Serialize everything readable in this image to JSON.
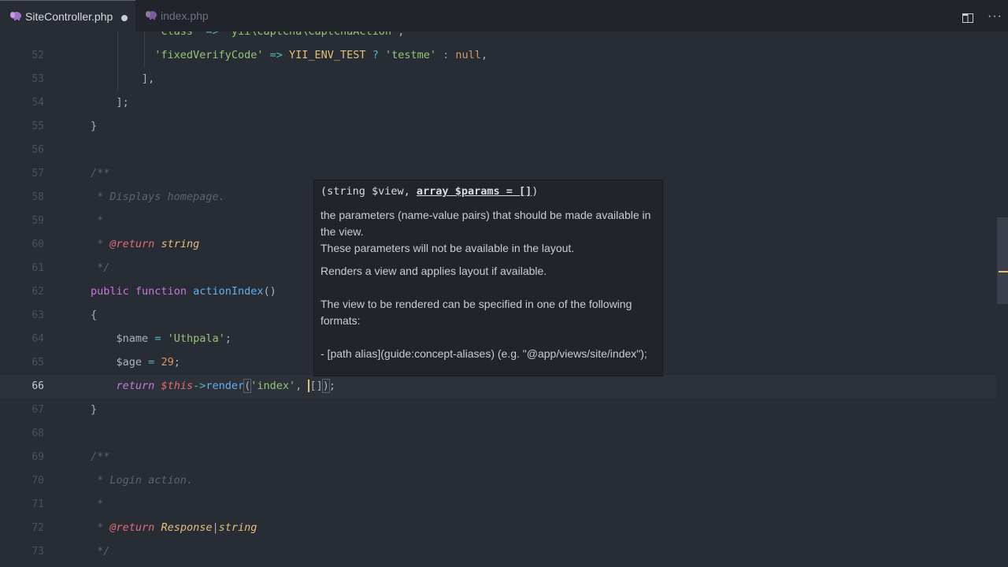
{
  "tabs": [
    {
      "label": "SiteController.php",
      "active": true,
      "modified": true
    },
    {
      "label": "index.php",
      "active": false,
      "modified": false
    }
  ],
  "header_actions": {
    "split_icon": "split-editor-icon",
    "more_label": "···"
  },
  "editor": {
    "current_line": 66,
    "lines": [
      {
        "n": "",
        "t": "            'class' => 'yii\\captcha\\CaptchaAction',"
      },
      {
        "n": "52",
        "t": "            'fixedVerifyCode' => YII_ENV_TEST ? 'testme' : null,"
      },
      {
        "n": "53",
        "t": "        ],"
      },
      {
        "n": "54",
        "t": "    ];"
      },
      {
        "n": "55",
        "t": "}"
      },
      {
        "n": "56",
        "t": ""
      },
      {
        "n": "57",
        "t": "/**"
      },
      {
        "n": "58",
        "t": " * Displays homepage."
      },
      {
        "n": "59",
        "t": " *"
      },
      {
        "n": "60",
        "t": " * @return string"
      },
      {
        "n": "61",
        "t": " */"
      },
      {
        "n": "62",
        "t": "public function actionIndex()"
      },
      {
        "n": "63",
        "t": "{"
      },
      {
        "n": "64",
        "t": "    $name = 'Uthpala';"
      },
      {
        "n": "65",
        "t": "    $age = 29;"
      },
      {
        "n": "66",
        "t": "    return $this->render('index', []);"
      },
      {
        "n": "67",
        "t": "}"
      },
      {
        "n": "68",
        "t": ""
      },
      {
        "n": "69",
        "t": "/**"
      },
      {
        "n": "70",
        "t": " * Login action."
      },
      {
        "n": "71",
        "t": " *"
      },
      {
        "n": "72",
        "t": " * @return Response|string"
      },
      {
        "n": "73",
        "t": " */"
      }
    ]
  },
  "tooltip": {
    "sig_plain": "(string $view, ",
    "sig_bold": "array $params = []",
    "sig_close": ")",
    "p1": "the parameters (name-value pairs) that should be made available in the view.",
    "p2": "These parameters will not be available in the layout.",
    "p3": "Renders a view and applies layout if available.",
    "p4": "The view to be rendered can be specified in one of the following formats:",
    "p5": "- [path alias](guide:concept-aliases) (e.g. \"@app/views/site/index\");"
  },
  "colors": {
    "background": "#282c34",
    "tab_bar": "#21252b",
    "keyword": "#c678dd",
    "function": "#61afef",
    "string": "#98c379",
    "variable": "#e06c75",
    "number": "#d19a66",
    "constant": "#e5c07b",
    "comment": "#5c6370"
  }
}
